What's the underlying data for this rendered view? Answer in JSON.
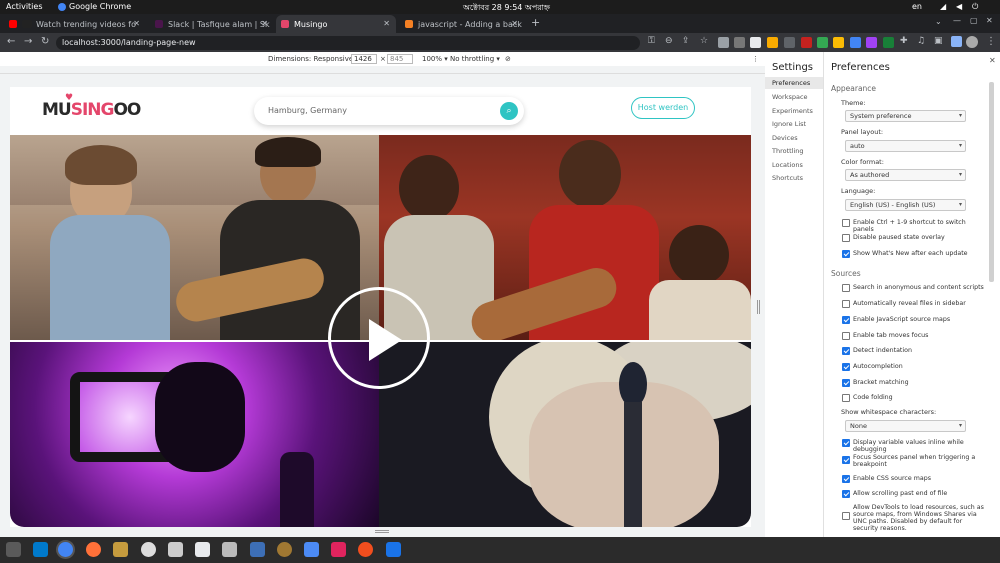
{
  "system_bar": {
    "activities": "Activities",
    "app_name": "Google Chrome",
    "clock": "অক্টোবর 28  9:54 অপরাহ্ন",
    "language": "en"
  },
  "tabs": [
    {
      "title": "Watch trending videos fo",
      "favicon_color": "#ff0000",
      "active": false
    },
    {
      "title": "Slack | Tasfique alam | Sk",
      "favicon_color": "#4a154b",
      "active": false
    },
    {
      "title": "Musingo",
      "favicon_color": "#e4466b",
      "active": true
    },
    {
      "title": "javascript - Adding a back",
      "favicon_color": "#f48024",
      "active": false
    }
  ],
  "address_bar": {
    "url": "localhost:3000/landing-page-new"
  },
  "device_toolbar": {
    "dimensions_label": "Dimensions: Responsive",
    "width": "1426",
    "height": "845",
    "zoom": "100%",
    "throttling": "No throttling"
  },
  "site": {
    "logo": {
      "part1": "MU",
      "part2": "SING",
      "part3": "OO"
    },
    "search_placeholder": "Hamburg, Germany",
    "host_button": "Host werden",
    "accent_color": "#2fc4c3"
  },
  "devtools": {
    "settings_title": "Settings",
    "nav": [
      "Preferences",
      "Workspace",
      "Experiments",
      "Ignore List",
      "Devices",
      "Throttling",
      "Locations",
      "Shortcuts"
    ],
    "selected_nav": "Preferences",
    "panel_title": "Preferences",
    "appearance": {
      "heading": "Appearance",
      "theme_label": "Theme:",
      "theme_value": "System preference",
      "panel_layout_label": "Panel layout:",
      "panel_layout_value": "auto",
      "color_format_label": "Color format:",
      "color_format_value": "As authored",
      "language_label": "Language:",
      "language_value": "English (US) - English (US)",
      "checks": [
        {
          "label": "Enable Ctrl + 1-9 shortcut to switch panels",
          "checked": false
        },
        {
          "label": "Disable paused state overlay",
          "checked": false
        },
        {
          "label": "Show What's New after each update",
          "checked": true
        }
      ]
    },
    "sources": {
      "heading": "Sources",
      "checks": [
        {
          "label": "Search in anonymous and content scripts",
          "checked": false
        },
        {
          "label": "Automatically reveal files in sidebar",
          "checked": false
        },
        {
          "label": "Enable JavaScript source maps",
          "checked": true
        },
        {
          "label": "Enable tab moves focus",
          "checked": false
        },
        {
          "label": "Detect indentation",
          "checked": true
        },
        {
          "label": "Autocompletion",
          "checked": true
        },
        {
          "label": "Bracket matching",
          "checked": true
        },
        {
          "label": "Code folding",
          "checked": false
        }
      ],
      "whitespace_label": "Show whitespace characters:",
      "whitespace_value": "None",
      "checks2": [
        {
          "label": "Display variable values inline while debugging",
          "checked": true
        },
        {
          "label": "Focus Sources panel when triggering a breakpoint",
          "checked": true
        },
        {
          "label": "Enable CSS source maps",
          "checked": true
        },
        {
          "label": "Allow scrolling past end of file",
          "checked": true
        },
        {
          "label": "Allow DevTools to load resources, such as source maps, from Windows Shares via UNC paths. Disabled by default for security reasons.",
          "checked": false
        }
      ]
    }
  }
}
